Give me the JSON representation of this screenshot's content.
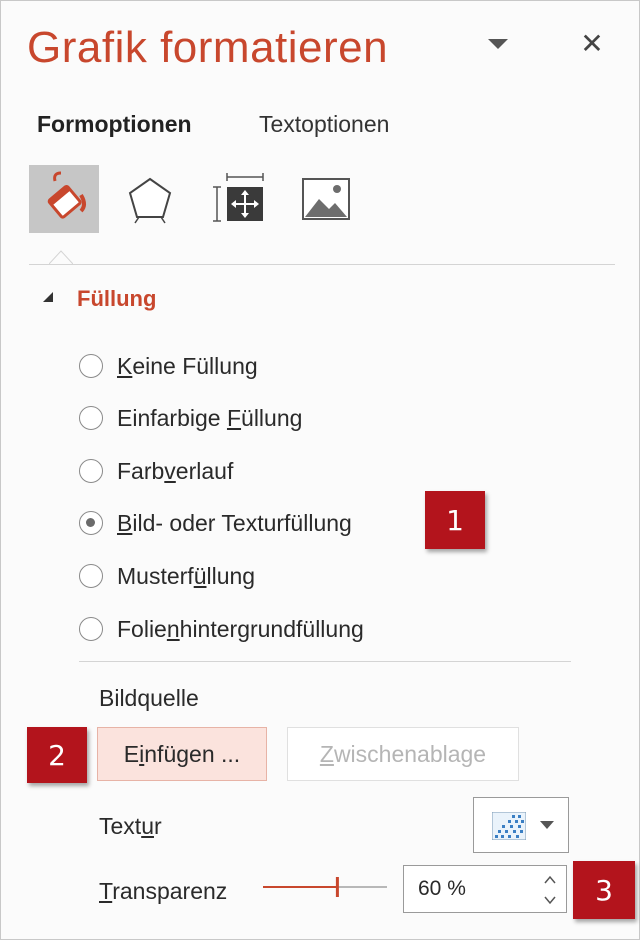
{
  "pane": {
    "title": "Grafik formatieren",
    "close_glyph": "✕",
    "pin_icon": "chevron-down-icon"
  },
  "tabs": [
    {
      "label": "Formoptionen",
      "active": true
    },
    {
      "label": "Textoptionen",
      "active": false
    }
  ],
  "icon_tabs": [
    {
      "icon": "paint-bucket-icon",
      "active": true
    },
    {
      "icon": "pentagon-icon",
      "active": false
    },
    {
      "icon": "size-position-icon",
      "active": false
    },
    {
      "icon": "picture-icon",
      "active": false
    }
  ],
  "section": {
    "title": "Füllung",
    "expanded": true
  },
  "fill_options": [
    {
      "pre": "",
      "u": "K",
      "post": "eine Füllung",
      "selected": false
    },
    {
      "pre": "Einfarbige ",
      "u": "F",
      "post": "üllung",
      "selected": false
    },
    {
      "pre": "Farb",
      "u": "v",
      "post": "erlauf",
      "selected": false
    },
    {
      "pre": "",
      "u": "B",
      "post": "ild- oder Texturfüllung",
      "selected": true
    },
    {
      "pre": "Musterf",
      "u": "ü",
      "post": "llung",
      "selected": false
    },
    {
      "pre": "Folie",
      "u": "n",
      "post": "hintergrundfüllung",
      "selected": false
    }
  ],
  "bildquelle": {
    "label": "Bildquelle",
    "insert": {
      "pre": "E",
      "u": "i",
      "post": "nfügen ..."
    },
    "clipboard": {
      "pre": "",
      "u": "Z",
      "post": "wischenablage",
      "enabled": false
    }
  },
  "textur": {
    "label_pre": "Text",
    "label_u": "u",
    "label_post": "r",
    "swatch_icon": "texture-swatch-icon"
  },
  "transparenz": {
    "label_pre": "",
    "label_u": "T",
    "label_post": "ransparenz",
    "value_text": "60 %",
    "value": 0.6
  },
  "callouts": [
    "1",
    "2",
    "3"
  ],
  "colors": {
    "accent": "#c8472d",
    "callout": "#b3141c",
    "active_tab_bg": "#c6c6c6",
    "insert_button_bg": "#fbe3dd"
  }
}
